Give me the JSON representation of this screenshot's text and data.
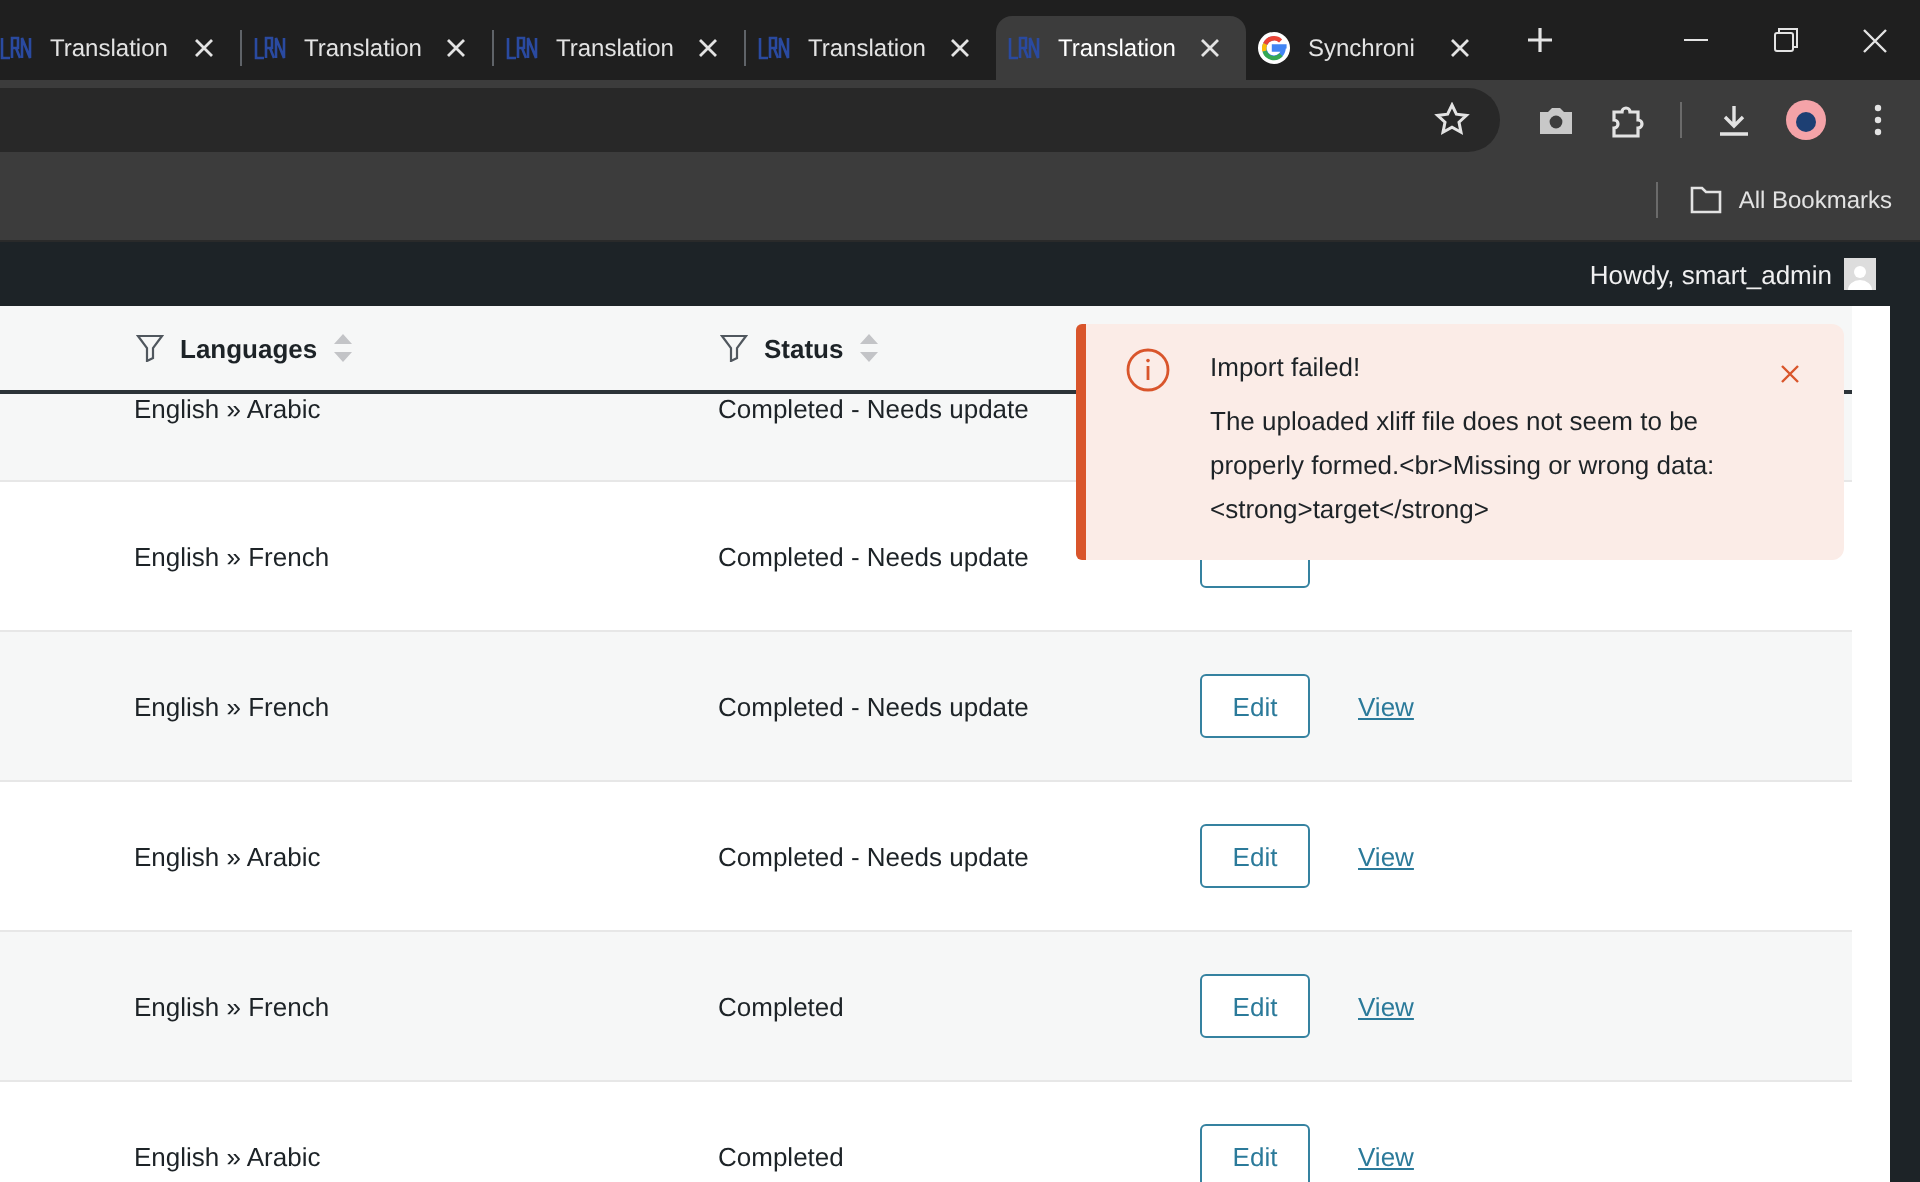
{
  "browser": {
    "tabs": [
      {
        "title": "Translation",
        "kind": "logo",
        "selected": false
      },
      {
        "title": "Translation",
        "kind": "logo",
        "selected": false
      },
      {
        "title": "Translation",
        "kind": "logo",
        "selected": false
      },
      {
        "title": "Translation",
        "kind": "logo",
        "selected": false
      },
      {
        "title": "Translation",
        "kind": "logo",
        "selected": true
      },
      {
        "title": "Synchroni",
        "kind": "google",
        "selected": false
      }
    ],
    "bookmarks_folder": "All Bookmarks"
  },
  "admin_bar": {
    "greeting": "Howdy, smart_admin"
  },
  "table": {
    "columns": [
      {
        "label": "Languages",
        "filter": true,
        "sortable": true
      },
      {
        "label": "Status",
        "filter": true,
        "sortable": true
      }
    ],
    "rows": [
      {
        "languages": "English » Arabic",
        "status": "Completed - Needs update",
        "actions": []
      },
      {
        "languages": "English » French",
        "status": "Completed - Needs update",
        "actions": [
          {
            "kind": "button_frame"
          }
        ]
      },
      {
        "languages": "English » French",
        "status": "Completed - Needs update",
        "actions": [
          {
            "kind": "button",
            "label": "Edit"
          },
          {
            "kind": "link",
            "label": "View"
          }
        ]
      },
      {
        "languages": "English » Arabic",
        "status": "Completed - Needs update",
        "actions": [
          {
            "kind": "button",
            "label": "Edit"
          },
          {
            "kind": "link",
            "label": "View"
          }
        ]
      },
      {
        "languages": "English » French",
        "status": "Completed",
        "actions": [
          {
            "kind": "button",
            "label": "Edit"
          },
          {
            "kind": "link",
            "label": "View"
          }
        ]
      },
      {
        "languages": "English » Arabic",
        "status": "Completed",
        "actions": [
          {
            "kind": "button",
            "label": "Edit"
          },
          {
            "kind": "link",
            "label": "View"
          }
        ]
      }
    ]
  },
  "notice": {
    "kind": "error",
    "title": "Import failed!",
    "message": "The uploaded xliff file does not seem to be properly formed.<br>Missing or wrong data: <strong>target</strong>"
  }
}
